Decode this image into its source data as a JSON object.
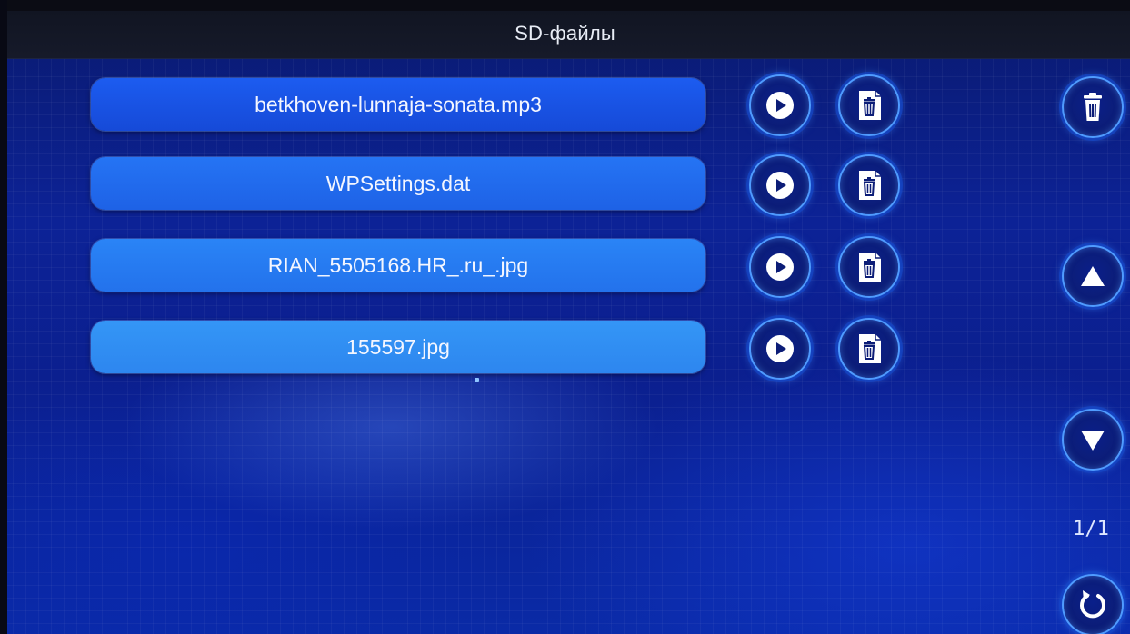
{
  "header": {
    "title": "SD-файлы"
  },
  "files": [
    {
      "name": "betkhoven-lunnaja-sonata.mp3"
    },
    {
      "name": "WPSettings.dat"
    },
    {
      "name": "RIAN_5505168.HR_.ru_.jpg"
    },
    {
      "name": "155597.jpg"
    }
  ],
  "pagination": {
    "text": "1/1"
  },
  "icons": {
    "play": "play-icon",
    "delete": "trash-icon",
    "delete_all": "trash-icon",
    "up": "arrow-up-icon",
    "down": "arrow-down-icon",
    "back": "refresh-back-icon"
  },
  "colors": {
    "accent": "#4f9bff",
    "row_text": "#f4f6ff",
    "button_fill": "#0c1d77",
    "title_bar": "#141826"
  }
}
